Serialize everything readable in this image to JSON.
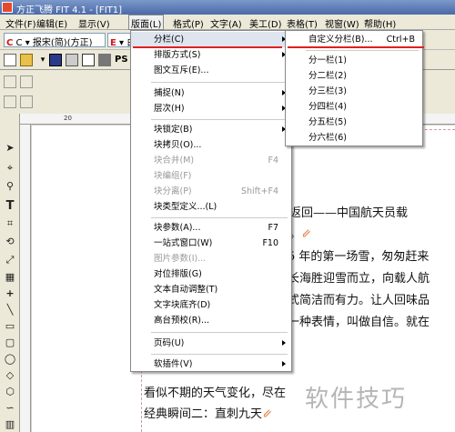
{
  "app": {
    "title": "方正飞腾 FIT 4.1 - [FIT1]"
  },
  "menubar": {
    "items": [
      "文件(F)",
      "编辑(E)",
      "显示(V)",
      "版面(L)",
      "格式(P)",
      "文字(A)",
      "美工(D)",
      "表格(T)",
      "视窗(W)",
      "帮助(H)"
    ],
    "active_index": 3
  },
  "toolbar": {
    "font_combo": "C ▾ 报宋(简)(方正)",
    "font_tag_left": "C",
    "font_tag_right": "E",
    "font_combo2": "▾ 白三",
    "ps_label": "PS"
  },
  "ruler": {
    "h_mark": "20"
  },
  "layout_menu": {
    "items": [
      {
        "label": "分栏(C)",
        "shortcut": "",
        "submenu": true,
        "enabled": true,
        "highlight": true
      },
      {
        "label": "排版方式(S)",
        "shortcut": "",
        "submenu": true,
        "enabled": true
      },
      {
        "label": "图文互斥(E)...",
        "shortcut": "",
        "submenu": false,
        "enabled": true
      },
      {
        "label": "捕捉(N)",
        "shortcut": "",
        "submenu": true,
        "enabled": true
      },
      {
        "label": "层次(H)",
        "shortcut": "",
        "submenu": true,
        "enabled": true
      },
      {
        "label": "块锁定(B)",
        "shortcut": "",
        "submenu": true,
        "enabled": true
      },
      {
        "label": "块拷贝(O)...",
        "shortcut": "",
        "submenu": false,
        "enabled": true
      },
      {
        "label": "块合并(M)",
        "shortcut": "F4",
        "submenu": false,
        "enabled": false
      },
      {
        "label": "块编组(F)",
        "shortcut": "",
        "submenu": false,
        "enabled": false
      },
      {
        "label": "块分离(P)",
        "shortcut": "Shift+F4",
        "submenu": false,
        "enabled": false
      },
      {
        "label": "块类型定义...(L)",
        "shortcut": "",
        "submenu": false,
        "enabled": true
      },
      {
        "label": "块参数(A)...",
        "shortcut": "F7",
        "submenu": false,
        "enabled": true
      },
      {
        "label": "一站式窗口(W)",
        "shortcut": "F10",
        "submenu": false,
        "enabled": true
      },
      {
        "label": "图片参数(I)...",
        "shortcut": "",
        "submenu": false,
        "enabled": false
      },
      {
        "label": "对位排版(G)",
        "shortcut": "",
        "submenu": false,
        "enabled": true
      },
      {
        "label": "文本自动调整(T)",
        "shortcut": "",
        "submenu": false,
        "enabled": true
      },
      {
        "label": "文字块底齐(D)",
        "shortcut": "",
        "submenu": false,
        "enabled": true
      },
      {
        "label": "高台预校(R)...",
        "shortcut": "",
        "submenu": false,
        "enabled": true
      },
      {
        "label": "页码(U)",
        "shortcut": "",
        "submenu": true,
        "enabled": true
      },
      {
        "label": "软插件(V)",
        "shortcut": "",
        "submenu": true,
        "enabled": true
      }
    ]
  },
  "columns_submenu": {
    "items": [
      {
        "label": "自定义分栏(B)...",
        "shortcut": "Ctrl+B"
      },
      {
        "label": "分一栏(1)",
        "shortcut": ""
      },
      {
        "label": "分二栏(2)",
        "shortcut": ""
      },
      {
        "label": "分三栏(3)",
        "shortcut": ""
      },
      {
        "label": "分四栏(4)",
        "shortcut": ""
      },
      {
        "label": "分五栏(5)",
        "shortcut": ""
      },
      {
        "label": "分六栏(6)",
        "shortcut": ""
      }
    ]
  },
  "document": {
    "lines": [
      "返回——中国航天员载",
      "。",
      "5 年的第一场雪，匆匆赶来",
      "长海胜迎雪而立，向载人航",
      "式简洁而有力。让人回味品",
      "一种表情，叫做自信。就在",
      "看似不期的天气变化，尽在",
      "经典瞬间二：直刺九天"
    ]
  },
  "watermark": "软件技巧",
  "colors": {
    "accent_red": "#e02020",
    "title_blue": "#4a6aa8"
  }
}
